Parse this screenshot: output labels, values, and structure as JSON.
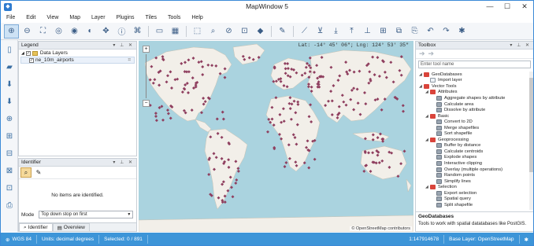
{
  "window": {
    "title": "MapWindow 5",
    "minimize": "—",
    "maximize": "☐",
    "close": "✕"
  },
  "menu": [
    "File",
    "Edit",
    "View",
    "Map",
    "Layer",
    "Plugins",
    "Tiles",
    "Tools",
    "Help"
  ],
  "legend": {
    "title": "Legend",
    "group_label": "Data Layers",
    "layer_label": "ne_10m_airports"
  },
  "identifier": {
    "title": "Identifier",
    "empty_text": "No items are identified.",
    "mode_label": "Mode",
    "mode_value": "Top down stop on first",
    "tabs": [
      "Identifier",
      "Overview"
    ]
  },
  "map": {
    "coords": "Lat: -14° 45' 06\"; Lng: 124° 53' 35\"",
    "attribution": "© OpenStreetMap contributors",
    "zoom_in": "+",
    "zoom_out": "−",
    "colors": {
      "water": "#aad3df",
      "land": "#f2efe9",
      "point": "#8f3f5f"
    }
  },
  "toolbox": {
    "title": "Toolbox",
    "search_placeholder": "Enter tool name",
    "tree": [
      {
        "level": 0,
        "type": "group",
        "label": "GeoDatabases"
      },
      {
        "level": 1,
        "type": "tool",
        "label": "Import layer"
      },
      {
        "level": 0,
        "type": "group",
        "label": "Vector Tools"
      },
      {
        "level": 1,
        "type": "group",
        "label": "Attributes"
      },
      {
        "level": 2,
        "type": "tool",
        "label": "Aggregate shapes by attribute"
      },
      {
        "level": 2,
        "type": "tool",
        "label": "Calculate area"
      },
      {
        "level": 2,
        "type": "tool",
        "label": "Dissolve by attribute"
      },
      {
        "level": 1,
        "type": "group",
        "label": "Basic"
      },
      {
        "level": 2,
        "type": "tool",
        "label": "Convert to 2D"
      },
      {
        "level": 2,
        "type": "tool",
        "label": "Merge shapefiles"
      },
      {
        "level": 2,
        "type": "tool",
        "label": "Sort shapefile"
      },
      {
        "level": 1,
        "type": "group",
        "label": "Geoprocessing"
      },
      {
        "level": 2,
        "type": "tool",
        "label": "Buffer by distance"
      },
      {
        "level": 2,
        "type": "tool",
        "label": "Calculate centroids"
      },
      {
        "level": 2,
        "type": "tool",
        "label": "Explode shapes"
      },
      {
        "level": 2,
        "type": "tool",
        "label": "Interactive clipping"
      },
      {
        "level": 2,
        "type": "tool",
        "label": "Overlay (multiple operations)"
      },
      {
        "level": 2,
        "type": "tool",
        "label": "Random points"
      },
      {
        "level": 2,
        "type": "tool",
        "label": "Simplify lines"
      },
      {
        "level": 1,
        "type": "group",
        "label": "Selection"
      },
      {
        "level": 2,
        "type": "tool",
        "label": "Export selection"
      },
      {
        "level": 2,
        "type": "tool",
        "label": "Spatial query"
      },
      {
        "level": 2,
        "type": "tool",
        "label": "Split shapefile"
      }
    ],
    "desc_title": "GeoDatabases",
    "desc_text": "Tools to work with spatial datatabases like PostGIS."
  },
  "status": {
    "crs": "WGS 84",
    "units": "Units: decimal degrees",
    "selected": "Selected: 0 / 891",
    "scale": "1:147914678",
    "base_layer": "Base Layer: OpenStreetMap"
  }
}
